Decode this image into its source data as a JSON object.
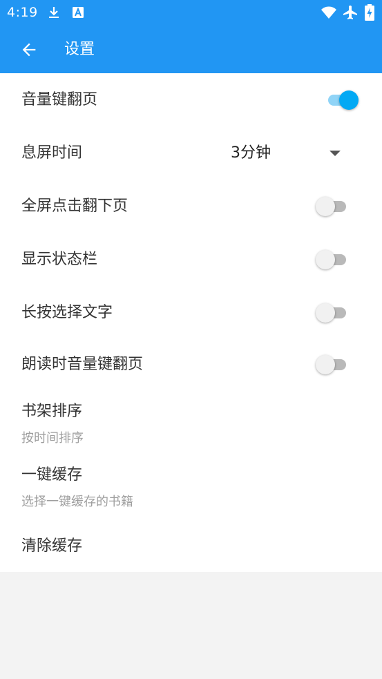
{
  "status_bar": {
    "time": "4:19",
    "icons": [
      "download-icon",
      "text-a-icon",
      "wifi-icon",
      "airplane-icon",
      "battery-charging-icon"
    ]
  },
  "app_bar": {
    "title": "设置",
    "back_icon": "arrow-left-icon"
  },
  "theme": {
    "primary": "#2196f3",
    "accent": "#03a9f4",
    "background": "#f3f3f3",
    "surface": "#ffffff"
  },
  "settings": {
    "volume_key_page": {
      "label": "音量键翻页",
      "checked": true
    },
    "screen_timeout": {
      "label": "息屏时间",
      "value": "3分钟"
    },
    "fullscreen_tap_next": {
      "label": "全屏点击翻下页",
      "checked": false
    },
    "show_status_bar": {
      "label": "显示状态栏",
      "checked": false
    },
    "long_press_select": {
      "label": "长按选择文字",
      "checked": false
    },
    "read_aloud_volume_page": {
      "label": "朗读时音量键翻页",
      "checked": false
    },
    "bookshelf_sort": {
      "label": "书架排序",
      "summary": "按时间排序"
    },
    "one_key_cache": {
      "label": "一键缓存",
      "summary": "选择一键缓存的书籍"
    },
    "clear_cache": {
      "label": "清除缓存"
    }
  }
}
